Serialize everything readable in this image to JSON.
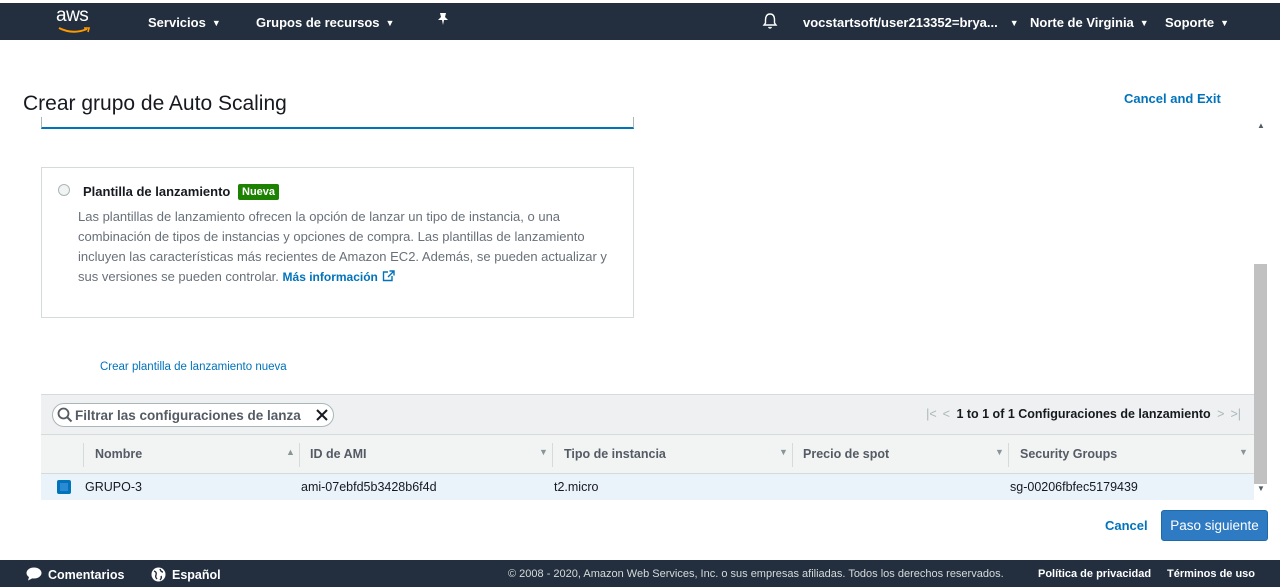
{
  "topnav": {
    "logo": "aws",
    "services": "Servicios",
    "resource_groups": "Grupos de recursos",
    "account": "vocstartsoft/user213352=brya...",
    "region": "Norte de Virginia",
    "support": "Soporte"
  },
  "header": {
    "title": "Crear grupo de Auto Scaling",
    "cancel_exit": "Cancel and Exit"
  },
  "launch_template": {
    "title": "Plantilla de lanzamiento",
    "badge": "Nueva",
    "description": "Las plantillas de lanzamiento ofrecen la opción de lanzar un tipo de instancia, o una combinación de tipos de instancias y opciones de compra. Las plantillas de lanzamiento incluyen las características más recientes de Amazon EC2. Además, se pueden actualizar y sus versiones se pueden controlar.",
    "more_info": "Más información",
    "create_link": "Crear plantilla de lanzamiento nueva"
  },
  "table": {
    "filter_placeholder": "Filtrar las configuraciones de lanza",
    "pagination": "1 to 1 of 1 Configuraciones de lanzamiento",
    "columns": [
      "Nombre",
      "ID de AMI",
      "Tipo de instancia",
      "Precio de spot",
      "Security Groups"
    ],
    "rows": [
      {
        "name": "GRUPO-3",
        "ami": "ami-07ebfd5b3428b6f4d",
        "instance_type": "t2.micro",
        "spot_price": "",
        "security_groups": "sg-00206fbfec5179439"
      }
    ]
  },
  "actions": {
    "cancel": "Cancel",
    "next": "Paso siguiente"
  },
  "footer": {
    "feedback": "Comentarios",
    "language": "Español",
    "copyright": "© 2008 - 2020, Amazon Web Services, Inc. o sus empresas afiliadas. Todos los derechos reservados.",
    "privacy": "Política de privacidad",
    "terms": "Términos de uso"
  },
  "colors": {
    "nav_bg": "#232f3e",
    "link": "#0073bb",
    "badge": "#1d8102",
    "primary_button": "#2e7bc4"
  }
}
